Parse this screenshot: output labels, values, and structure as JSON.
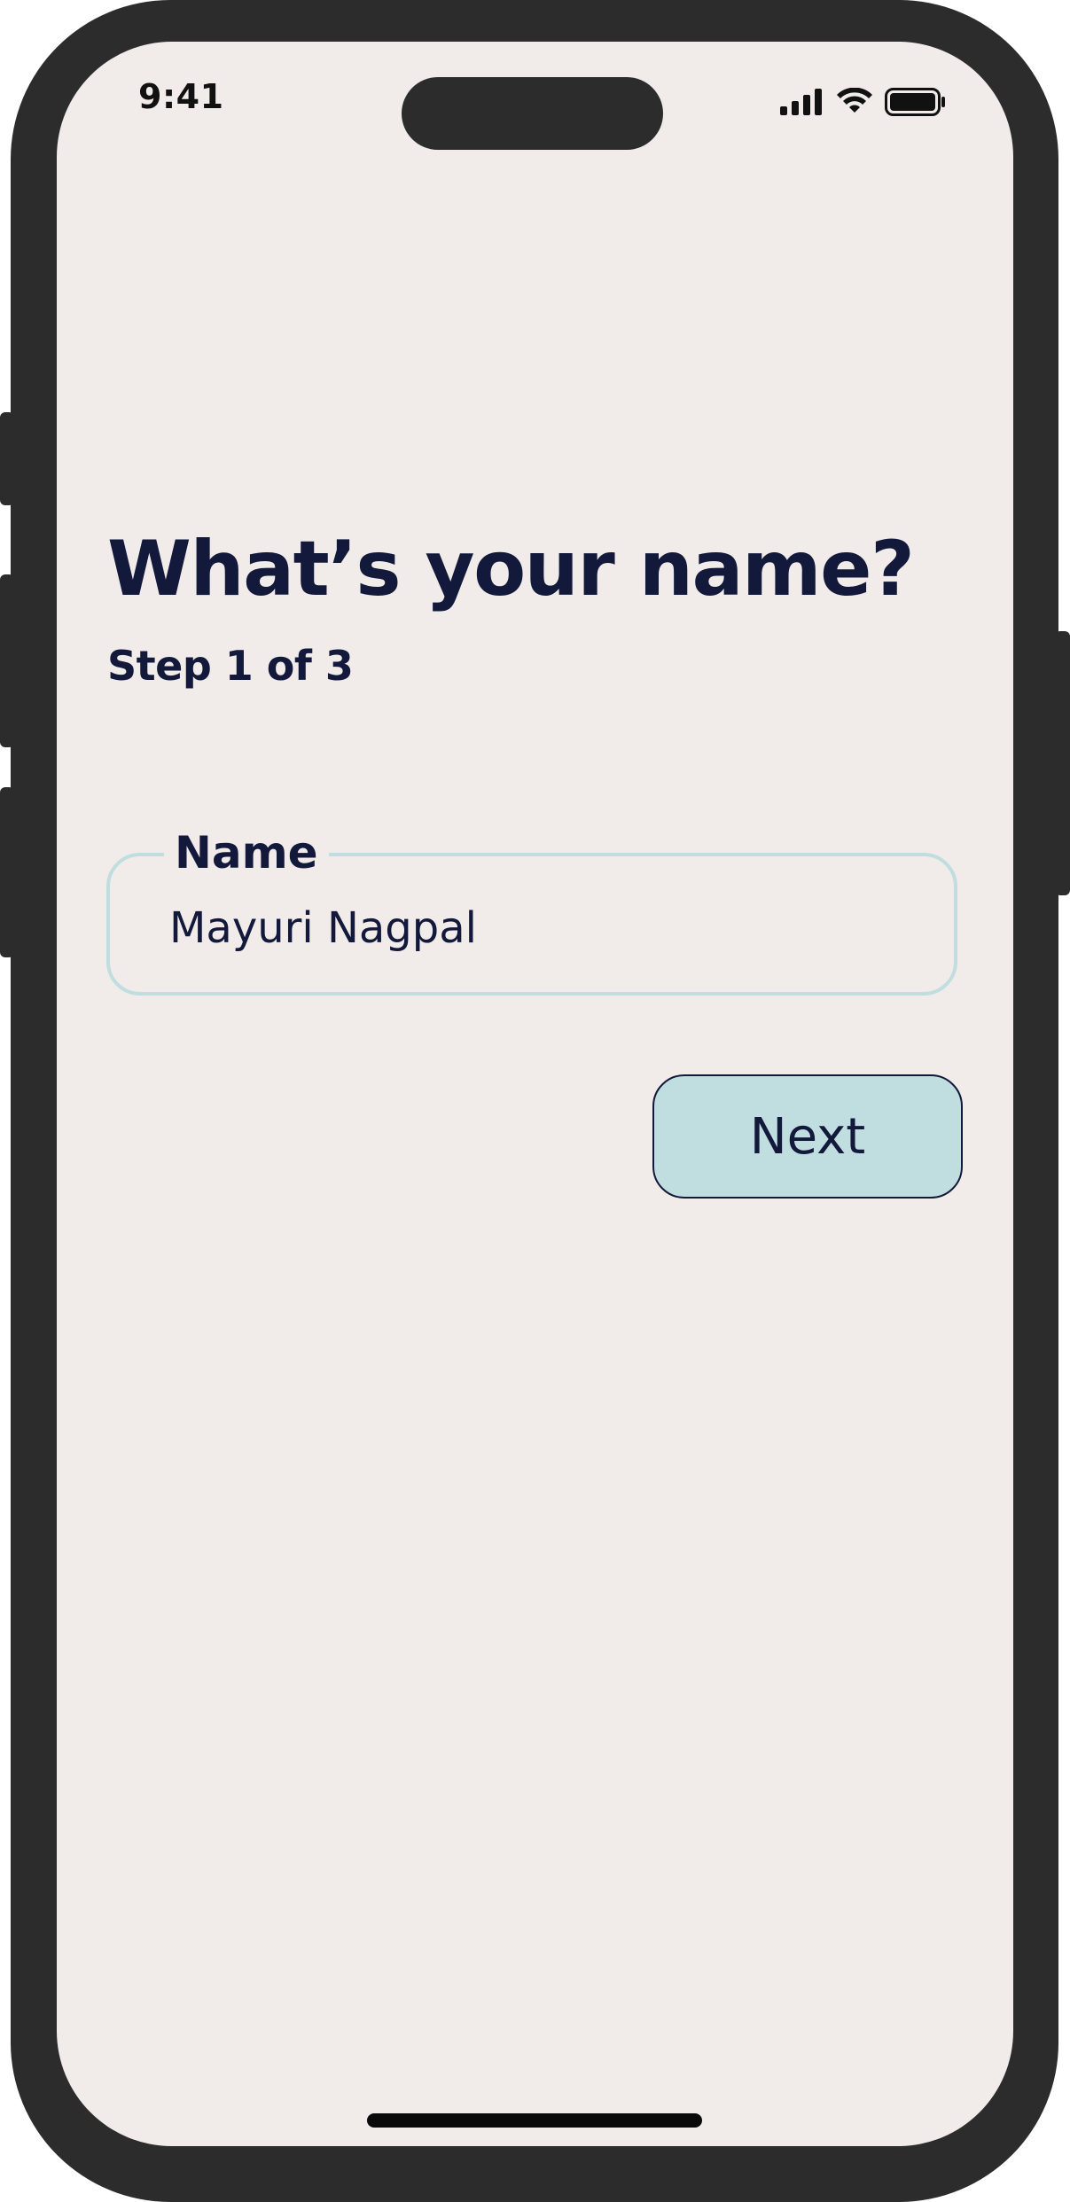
{
  "status_bar": {
    "time": "9:41",
    "signal_icon": "cellular-signal-icon",
    "wifi_icon": "wifi-icon",
    "battery_icon": "battery-icon"
  },
  "page": {
    "title": "What’s your name?",
    "step": "Step 1 of 3"
  },
  "name_field": {
    "label": "Name",
    "value": "Mayuri Nagpal"
  },
  "actions": {
    "next_label": "Next"
  },
  "colors": {
    "screen_background": "#f1ece9",
    "text": "#13193a",
    "accent": "#c0dedf",
    "frame": "#2c2c2c"
  }
}
